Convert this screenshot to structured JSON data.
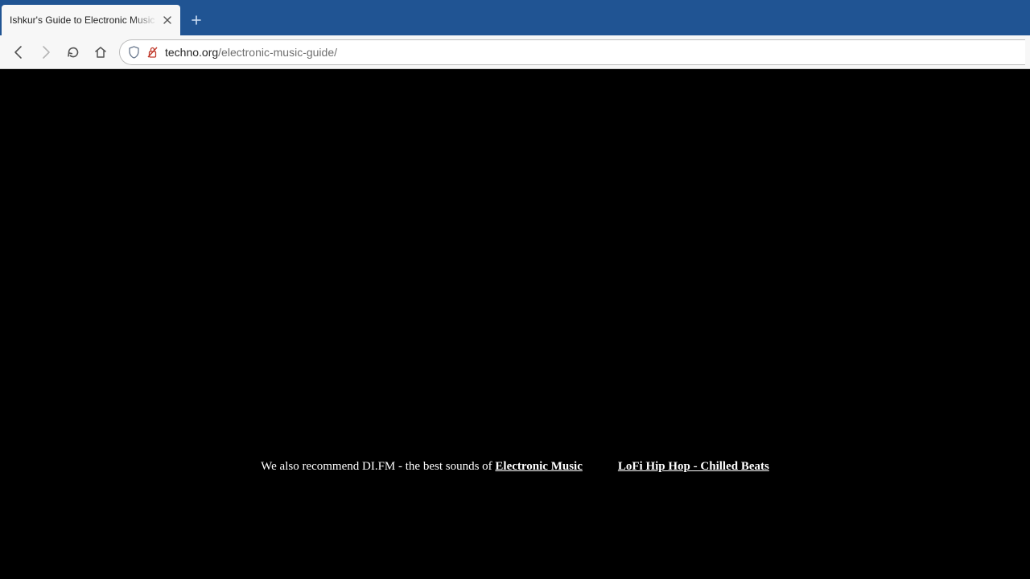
{
  "browser": {
    "tab_title": "Ishkur's Guide to Electronic Music |",
    "url_domain": "techno.org",
    "url_path": "/electronic-music-guide/"
  },
  "page": {
    "recommend_prefix": "We also recommend DI.FM - the best sounds of ",
    "link1": "Electronic Music",
    "link2": "LoFi Hip Hop - Chilled Beats"
  }
}
